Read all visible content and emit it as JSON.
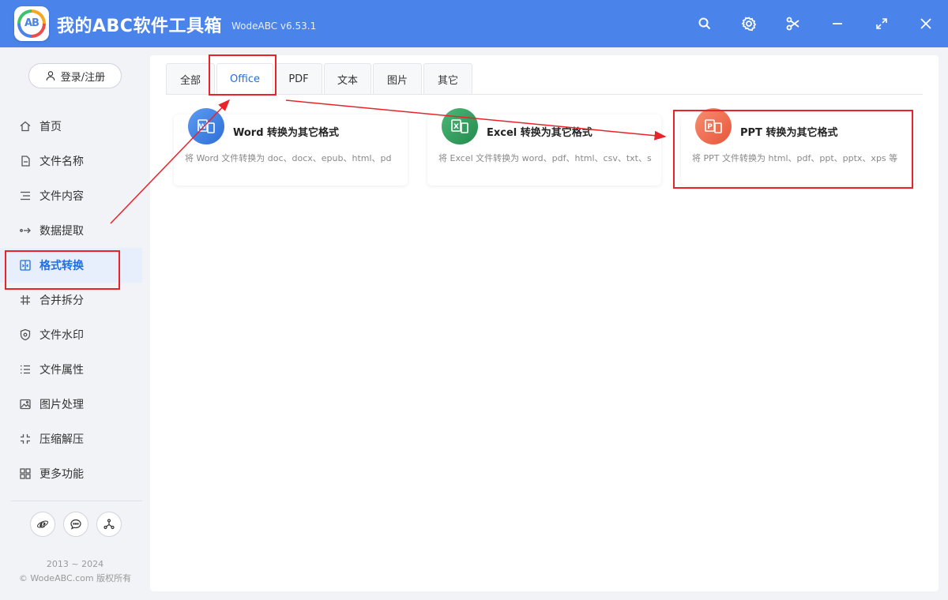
{
  "app": {
    "title": "我的ABC软件工具箱",
    "version": "WodeABC v6.53.1",
    "logo_text": "AB"
  },
  "window_controls": [
    "search-icon",
    "gear-icon",
    "scissors-icon",
    "minimize-icon",
    "maximize-icon",
    "close-icon"
  ],
  "sidebar": {
    "login_label": "登录/注册",
    "items": [
      {
        "label": "首页",
        "icon": "home-icon"
      },
      {
        "label": "文件名称",
        "icon": "file-name-icon"
      },
      {
        "label": "文件内容",
        "icon": "file-content-icon"
      },
      {
        "label": "数据提取",
        "icon": "data-extract-icon"
      },
      {
        "label": "格式转换",
        "icon": "format-convert-icon",
        "active": true
      },
      {
        "label": "合并拆分",
        "icon": "merge-split-icon"
      },
      {
        "label": "文件水印",
        "icon": "watermark-icon"
      },
      {
        "label": "文件属性",
        "icon": "file-properties-icon"
      },
      {
        "label": "图片处理",
        "icon": "image-process-icon"
      },
      {
        "label": "压缩解压",
        "icon": "compress-icon"
      },
      {
        "label": "更多功能",
        "icon": "more-features-icon"
      }
    ],
    "bottom_icons": [
      "ie-browser-icon",
      "chat-icon",
      "share-icon"
    ],
    "copyright_years": "2013 ~ 2024",
    "copyright_text": "© WodeABC.com 版权所有"
  },
  "tabs": [
    {
      "label": "全部"
    },
    {
      "label": "Office",
      "active": true
    },
    {
      "label": "PDF"
    },
    {
      "label": "文本"
    },
    {
      "label": "图片"
    },
    {
      "label": "其它"
    }
  ],
  "cards": [
    {
      "title": "Word 转换为其它格式",
      "desc": "将 Word 文件转换为 doc、docx、epub、html、pd",
      "icon": "word-icon",
      "color": "#3b7be0"
    },
    {
      "title": "Excel 转换为其它格式",
      "desc": "将 Excel 文件转换为 word、pdf、html、csv、txt、s",
      "icon": "excel-icon",
      "color": "#2f9e5b"
    },
    {
      "title": "PPT 转换为其它格式",
      "desc": "将 PPT 文件转换为 html、pdf、ppt、pptx、xps 等",
      "icon": "ppt-icon",
      "color": "#ef6a4a"
    }
  ],
  "colors": {
    "titlebar": "#4a83ea",
    "accent": "#1f6fe5",
    "annotation": "#e8232a"
  }
}
